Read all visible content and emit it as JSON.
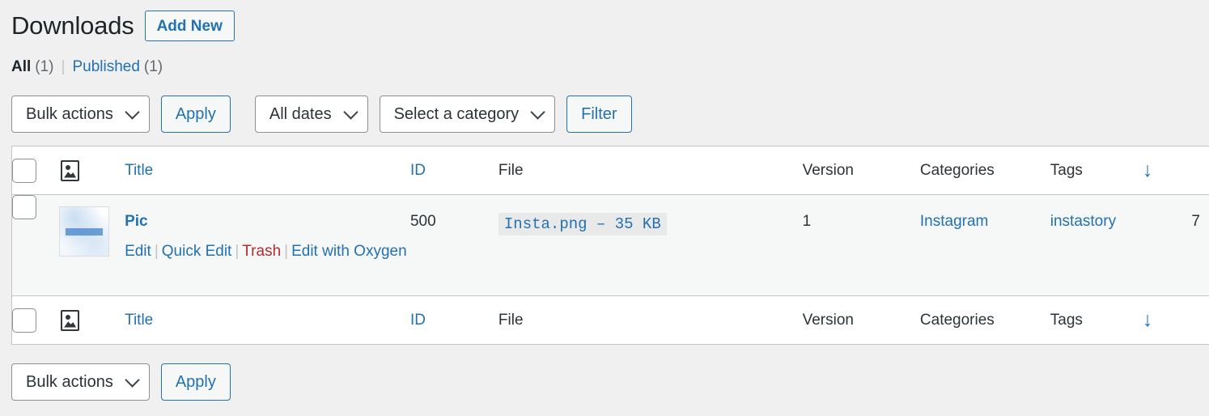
{
  "header": {
    "title": "Downloads",
    "add_new_label": "Add New"
  },
  "views": {
    "all_label": "All",
    "all_count": "(1)",
    "separator": "|",
    "published_label": "Published",
    "published_count": "(1)"
  },
  "tablenav_top": {
    "bulk_actions_label": "Bulk actions",
    "apply_label": "Apply",
    "dates_label": "All dates",
    "category_label": "Select a category",
    "filter_label": "Filter"
  },
  "table": {
    "columns": {
      "title": "Title",
      "id": "ID",
      "file": "File",
      "version": "Version",
      "categories": "Categories",
      "tags": "Tags",
      "downloads_sort_icon": "↓",
      "thumbnail_icon": "image-icon"
    },
    "rows": [
      {
        "title": "Pic",
        "id": "500",
        "file": "Insta.png – 35 KB",
        "version": "1",
        "categories": "Instagram",
        "tags": "instastory",
        "downloads": "7",
        "actions": {
          "edit": "Edit",
          "quick_edit": "Quick Edit",
          "trash": "Trash",
          "edit_with_oxygen": "Edit with Oxygen",
          "separator": "|"
        }
      }
    ]
  },
  "tablenav_bottom": {
    "bulk_actions_label": "Bulk actions",
    "apply_label": "Apply"
  },
  "colors": {
    "link": "#2271b1",
    "danger": "#b32d2e",
    "text": "#1d2327",
    "background": "#f0f0f1",
    "row_background": "#f6f7f7",
    "border": "#c3c4c7"
  }
}
